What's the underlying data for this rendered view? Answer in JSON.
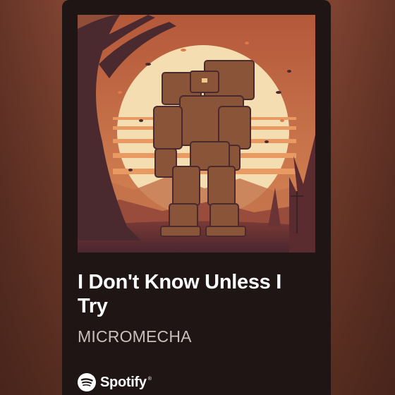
{
  "track": {
    "title": "I Don't Know Unless I Try",
    "artist": "MICROMECHA"
  },
  "branding": {
    "logo_icon": "spotify-logo-icon",
    "wordmark": "Spotify",
    "registered": "®"
  },
  "colors": {
    "card_background": "#1e1514",
    "page_background": "#7c4232",
    "artwork_sun": "#f4ddb0",
    "artwork_orange": "#d9824c",
    "artwork_dark": "#4a2a2e"
  }
}
